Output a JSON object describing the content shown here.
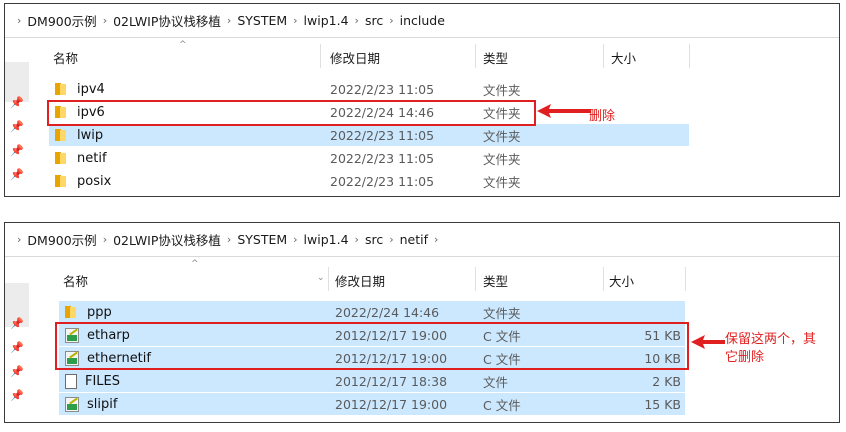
{
  "panel1": {
    "breadcrumb": [
      "DM900示例",
      "02LWIP协议栈移植",
      "SYSTEM",
      "lwip1.4",
      "src",
      "include"
    ],
    "columns": {
      "name": "名称",
      "date": "修改日期",
      "type": "类型",
      "size": "大小"
    },
    "rows": [
      {
        "name": "ipv4",
        "date": "2022/2/23 11:05",
        "type": "文件夹",
        "size": "",
        "icon": "folder-icon"
      },
      {
        "name": "ipv6",
        "date": "2022/2/24 14:46",
        "type": "文件夹",
        "size": "",
        "icon": "folder-icon"
      },
      {
        "name": "lwip",
        "date": "2022/2/23 11:05",
        "type": "文件夹",
        "size": "",
        "icon": "folder-icon"
      },
      {
        "name": "netif",
        "date": "2022/2/23 11:05",
        "type": "文件夹",
        "size": "",
        "icon": "folder-icon"
      },
      {
        "name": "posix",
        "date": "2022/2/23 11:05",
        "type": "文件夹",
        "size": "",
        "icon": "folder-icon"
      }
    ],
    "annotation": "删除"
  },
  "panel2": {
    "breadcrumb": [
      "DM900示例",
      "02LWIP协议栈移植",
      "SYSTEM",
      "lwip1.4",
      "src",
      "netif"
    ],
    "columns": {
      "name": "名称",
      "date": "修改日期",
      "type": "类型",
      "size": "大小"
    },
    "rows": [
      {
        "name": "ppp",
        "date": "2022/2/24 14:46",
        "type": "文件夹",
        "size": "",
        "icon": "folder-icon"
      },
      {
        "name": "etharp",
        "date": "2012/12/17 19:00",
        "type": "C 文件",
        "size": "51 KB",
        "icon": "c-file-icon"
      },
      {
        "name": "ethernetif",
        "date": "2012/12/17 19:00",
        "type": "C 文件",
        "size": "10 KB",
        "icon": "c-file-icon"
      },
      {
        "name": "FILES",
        "date": "2012/12/17 18:38",
        "type": "文件",
        "size": "2 KB",
        "icon": "file-icon"
      },
      {
        "name": "slipif",
        "date": "2012/12/17 19:00",
        "type": "C 文件",
        "size": "15 KB",
        "icon": "c-file-icon"
      }
    ],
    "annotation_line1": "保留这两个，其",
    "annotation_line2": "它删除"
  },
  "colors": {
    "annotation": "#e02020",
    "selection": "#cce8ff",
    "folder": "#ffd766"
  }
}
